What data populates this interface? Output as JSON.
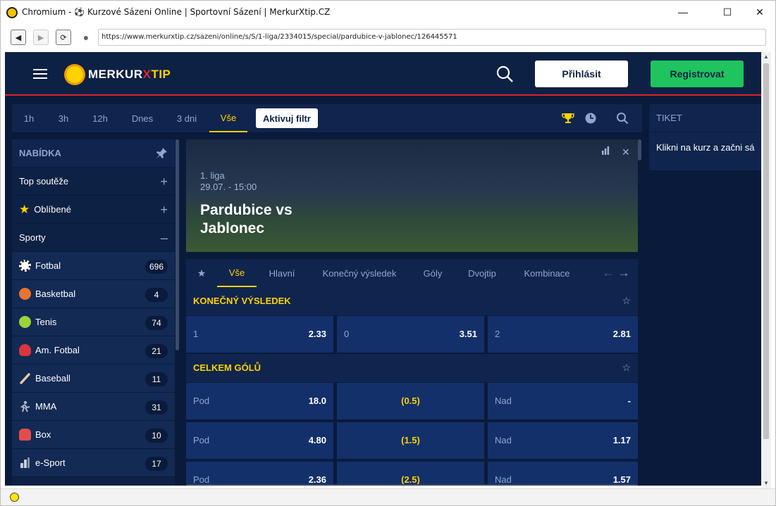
{
  "browser": {
    "window_title": "Chromium - ⚽ Kurzové Sázeni Online | Sportovní Sázení | MerkurXtip.CZ",
    "url": "https://www.merkurxtip.cz/sazeni/online/s/S/1-liga/2334015/special/pardubice-v-jablonec/126445571"
  },
  "header": {
    "logo_main": "MERKUR",
    "logo_x": "X",
    "logo_tip": "TIP",
    "login_label": "Přihlásit",
    "register_label": "Registrovat"
  },
  "time_filter": {
    "tabs": [
      "1h",
      "3h",
      "12h",
      "Dnes",
      "3 dni",
      "Vše"
    ],
    "active": "Vše",
    "apply_label": "Aktivuj filtr"
  },
  "ticket": {
    "title": "TIKET",
    "hint": "Klikni na kurz a začni sá"
  },
  "sidebar": {
    "offer_title": "NABÍDKA",
    "top_competitions": "Top soutěže",
    "favorites": "Oblíbené",
    "sports_label": "Sporty",
    "sports": [
      {
        "label": "Fotbal",
        "count": "696",
        "color": "#ffffff"
      },
      {
        "label": "Basketbal",
        "count": "4",
        "color": "#e8742f"
      },
      {
        "label": "Tenis",
        "count": "74",
        "color": "#9ed23b"
      },
      {
        "label": "Am. Fotbal",
        "count": "21",
        "color": "#d9363e"
      },
      {
        "label": "Baseball",
        "count": "11",
        "color": "#e7c9a1"
      },
      {
        "label": "MMA",
        "count": "31",
        "color": "#b0b8c8"
      },
      {
        "label": "Box",
        "count": "10",
        "color": "#e34c4c"
      },
      {
        "label": "e-Sport",
        "count": "17",
        "color": "#c8ccd6"
      }
    ]
  },
  "match": {
    "league": "1. liga",
    "datetime": "29.07. - 15:00",
    "title": "Pardubice vs Jablonec"
  },
  "market_tabs": [
    "Vše",
    "Hlavní",
    "Konečný výsledek",
    "Góly",
    "Dvojtip",
    "Kombinace"
  ],
  "markets": {
    "final_result": {
      "title": "KONEČNÝ VÝSLEDEK",
      "odds": [
        {
          "label": "1",
          "value": "2.33"
        },
        {
          "label": "0",
          "value": "3.51"
        },
        {
          "label": "2",
          "value": "2.81"
        }
      ]
    },
    "total_goals": {
      "title": "CELKEM GÓLŮ",
      "under_label": "Pod",
      "over_label": "Nad",
      "rows": [
        {
          "under": "18.0",
          "line": "(0.5)",
          "over": "-"
        },
        {
          "under": "4.80",
          "line": "(1.5)",
          "over": "1.17"
        },
        {
          "under": "2.36",
          "line": "(2.5)",
          "over": "1.57"
        }
      ]
    }
  }
}
